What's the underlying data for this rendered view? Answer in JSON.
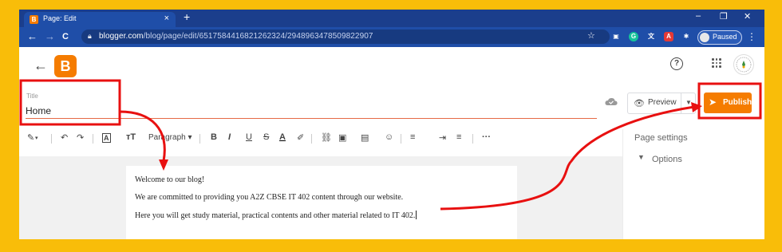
{
  "browser": {
    "tab_title": "Page: Edit",
    "tab_close": "×",
    "new_tab": "+",
    "window_controls": [
      "–",
      "❐",
      "✕"
    ],
    "nav": {
      "back": "←",
      "forward": "→",
      "reload": "C"
    },
    "url_host": "blogger.com",
    "url_path": "/blog/page/edit/6517584416821262324/2948963478509822907",
    "profile_status": "Paused",
    "menu_glyph": "⋮",
    "extensions": [
      {
        "name": "extension-icon",
        "color": "#9e9e9e",
        "glyph": "▣"
      },
      {
        "name": "grammarly-icon",
        "color": "#15c39a",
        "glyph": "G"
      },
      {
        "name": "translate-icon",
        "color": "#1f4ea8",
        "glyph": "文"
      },
      {
        "name": "pdf-icon",
        "color": "#e53935",
        "glyph": "A"
      },
      {
        "name": "puzzle-icon",
        "color": "#1f4ea8",
        "glyph": "✱"
      }
    ]
  },
  "header": {
    "back_icon": "←",
    "logo_glyph": "B",
    "help_glyph": "?"
  },
  "title": {
    "label": "Title",
    "value": "Home"
  },
  "actions": {
    "preview_label": "Preview",
    "preview_dropdown": "▼",
    "publish_label": "Publish"
  },
  "toolbar": {
    "paragraph_label": "Paragraph",
    "items": [
      "✎",
      "↶",
      "↷",
      "A",
      "тT",
      "B",
      "I",
      "U",
      "S",
      "A",
      "✐",
      "⛓",
      "▣",
      "▤",
      "☺",
      "≡",
      "⇥",
      "≡",
      "···"
    ]
  },
  "editor": {
    "paragraphs": [
      "Welcome to our blog!",
      "We are committed to providing you A2Z CBSE IT 402 content through our website.",
      "Here you will get study material, practical contents and other material related to IT 402."
    ]
  },
  "sidebar": {
    "title": "Page settings",
    "options_label": "Options",
    "options_chevron": "⌄"
  },
  "colors": {
    "page_background": "#f9bd09",
    "chrome_dark": "#1b3e8c",
    "chrome_bar": "#1f4ea8",
    "blogger_orange": "#f57c00",
    "annotation_red": "#e81010",
    "title_underline": "#e66a45"
  }
}
